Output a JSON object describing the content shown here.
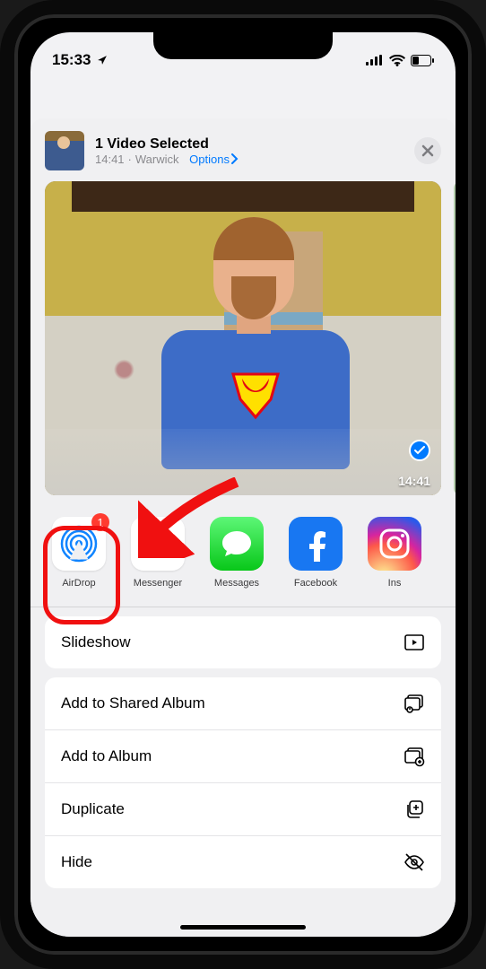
{
  "status_bar": {
    "time": "15:33"
  },
  "header": {
    "title": "1 Video Selected",
    "meta_time": "14:41",
    "meta_location": "Warwick",
    "options": "Options"
  },
  "preview": {
    "duration": "14:41"
  },
  "apps": [
    {
      "label": "AirDrop",
      "badge": "1"
    },
    {
      "label": "Messenger"
    },
    {
      "label": "Messages"
    },
    {
      "label": "Facebook"
    },
    {
      "label": "Ins"
    }
  ],
  "actions": {
    "0": "Slideshow",
    "1": "Add to Shared Album",
    "2": "Add to Album",
    "3": "Duplicate",
    "4": "Hide"
  }
}
